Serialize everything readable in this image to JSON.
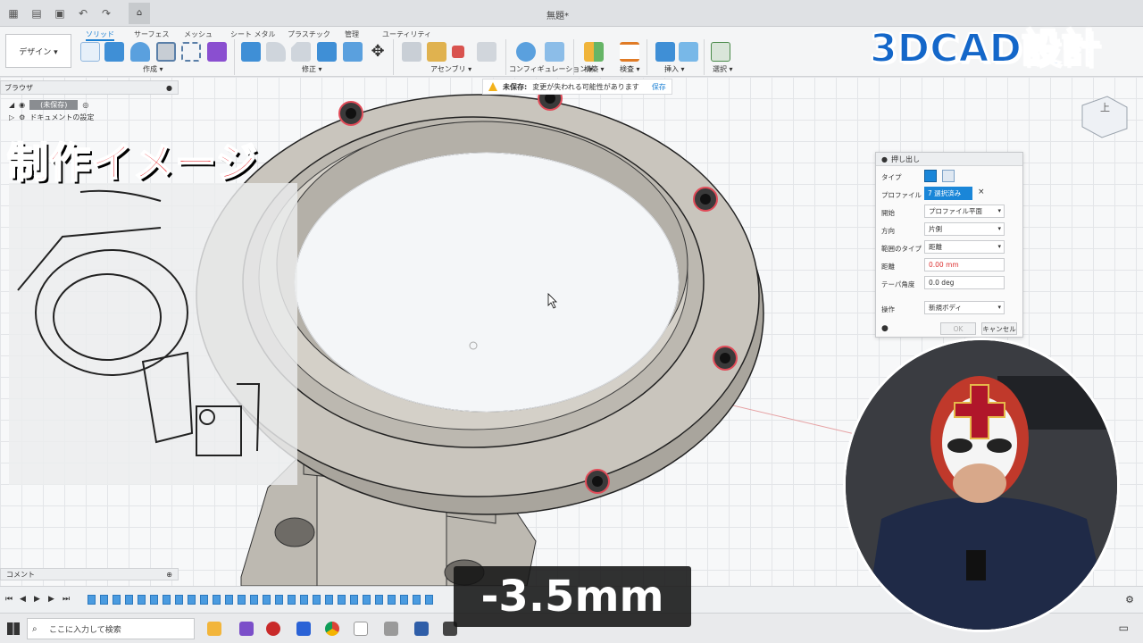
{
  "titlebar": {
    "doc_title": "無題*"
  },
  "ribbon": {
    "workspace": "デザイン ▾",
    "tabs": [
      "ソリッド",
      "サーフェス",
      "メッシュ",
      "シート メタル",
      "プラスチック",
      "管理",
      "ユーティリティ"
    ],
    "groups": [
      "作成 ▾",
      "修正 ▾",
      "アセンブリ ▾",
      "コンフィギュレーション ▾",
      "構築 ▾",
      "検査 ▾",
      "挿入 ▾",
      "選択 ▾"
    ]
  },
  "browser": {
    "title": "ブラウザ",
    "root": "(未保存)",
    "doc_settings": "ドキュメントの設定"
  },
  "overlay": {
    "title": "制作イメージ",
    "corner": "3DCAD設計",
    "caption": "-3.5mm"
  },
  "warning": {
    "label": "未保存:",
    "message": "変更が失われる可能性があります",
    "save": "保存"
  },
  "dialog": {
    "title": "押し出し",
    "type_label": "タイプ",
    "profile_label": "プロファイル",
    "profile_value": "7 選択済み",
    "start_label": "開始",
    "start_value": "プロファイル平面",
    "direction_label": "方向",
    "direction_value": "片側",
    "extent_label": "範囲のタイプ",
    "extent_value": "距離",
    "distance_label": "距離",
    "distance_value": "0.00 mm",
    "taper_label": "テーパ角度",
    "taper_value": "0.0 deg",
    "operation_label": "操作",
    "operation_value": "新規ボディ",
    "ok": "OK",
    "cancel": "キャンセル"
  },
  "comment": {
    "label": "コメント"
  },
  "taskbar": {
    "search_placeholder": "ここに入力して検索"
  },
  "viewcube": {
    "label": "上"
  },
  "colors": {
    "accent": "#1a86d8",
    "title_red": "#e8262b",
    "corner_blue": "#1467c9"
  }
}
